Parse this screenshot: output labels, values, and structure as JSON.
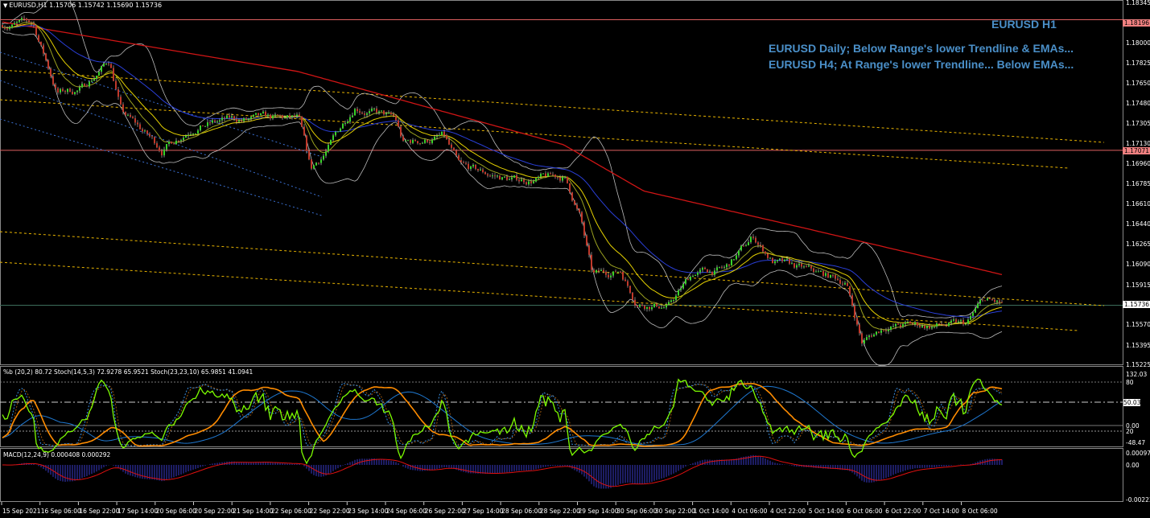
{
  "header": {
    "symbol": "EURUSD,H1",
    "ohlc": "1.15706 1.15742 1.15690 1.15736"
  },
  "annotations": [
    "EURUSD H1",
    "EURUSD Daily; Below Range's lower Trendline & EMAs...",
    "EURUSD H4; At Range's lower Trendline... Below EMAs..."
  ],
  "price_axis": [
    "1.18345",
    "1.18175",
    "1.18000",
    "1.17825",
    "1.17650",
    "1.17480",
    "1.17305",
    "1.17130",
    "1.16960",
    "1.16785",
    "1.16610",
    "1.16440",
    "1.16265",
    "1.16090",
    "1.15915",
    "1.15570",
    "1.15395",
    "1.15225"
  ],
  "price_tags": {
    "resistance": "1.18196",
    "support": "1.17071",
    "current": "1.15736"
  },
  "indicator_window": {
    "label": "%b (20,2) 80.72  Stoch(14,5,3) 72.9278 65.9521  Stoch(23,23,10) 65.9851 41.0941",
    "axis": [
      "132.03",
      "80",
      "50.03",
      "0.00",
      "20",
      "-48.47"
    ]
  },
  "macd_window": {
    "label": "MACD(12,24,9) 0.000408 0.000292",
    "axis": [
      "0.000973",
      "0.00",
      "-0.002224"
    ]
  },
  "time_axis": [
    "15 Sep 2021",
    "16 Sep 06:00",
    "16 Sep 22:00",
    "17 Sep 14:00",
    "20 Sep 06:00",
    "20 Sep 22:00",
    "21 Sep 14:00",
    "22 Sep 06:00",
    "22 Sep 22:00",
    "23 Sep 14:00",
    "24 Sep 06:00",
    "26 Sep 22:00",
    "27 Sep 14:00",
    "28 Sep 06:00",
    "28 Sep 22:00",
    "29 Sep 14:00",
    "30 Sep 06:00",
    "30 Sep 22:00",
    "1 Oct 14:00",
    "4 Oct 06:00",
    "4 Oct 22:00",
    "5 Oct 14:00",
    "6 Oct 06:00",
    "6 Oct 22:00",
    "7 Oct 14:00",
    "8 Oct 06:00"
  ],
  "colors": {
    "bull": "#39d22a",
    "bear": "#c0392b",
    "ema_slow": "#d01515",
    "ema_mid": "#2a3fd8",
    "ema_fast": "#e6d200",
    "trend": "#e8b400",
    "annotation": "#4a8fc8"
  },
  "chart_data": {
    "type": "candlestick",
    "price_path_anchors": [
      [
        0,
        1.1816
      ],
      [
        40,
        1.1816
      ],
      [
        70,
        1.1757
      ],
      [
        100,
        1.176
      ],
      [
        135,
        1.1785
      ],
      [
        150,
        1.174
      ],
      [
        200,
        1.1708
      ],
      [
        240,
        1.1729
      ],
      [
        290,
        1.1733
      ],
      [
        370,
        1.1733
      ],
      [
        385,
        1.1688
      ],
      [
        410,
        1.1712
      ],
      [
        440,
        1.1747
      ],
      [
        490,
        1.1733
      ],
      [
        500,
        1.1712
      ],
      [
        550,
        1.1719
      ],
      [
        570,
        1.1691
      ],
      [
        640,
        1.1681
      ],
      [
        700,
        1.1684
      ],
      [
        720,
        1.165
      ],
      [
        735,
        1.1598
      ],
      [
        770,
        1.1604
      ],
      [
        790,
        1.1577
      ],
      [
        830,
        1.1573
      ],
      [
        860,
        1.1601
      ],
      [
        900,
        1.1604
      ],
      [
        935,
        1.1632
      ],
      [
        960,
        1.1611
      ],
      [
        1010,
        1.1601
      ],
      [
        1050,
        1.1594
      ],
      [
        1070,
        1.1542
      ],
      [
        1100,
        1.1556
      ],
      [
        1200,
        1.1556
      ],
      [
        1220,
        1.1577
      ],
      [
        1245,
        1.15736
      ]
    ],
    "ema_slow_anchors": [
      [
        0,
        1.1818
      ],
      [
        370,
        1.1775
      ],
      [
        700,
        1.1712
      ],
      [
        800,
        1.1672
      ],
      [
        1000,
        1.164
      ],
      [
        1245,
        1.16
      ]
    ]
  }
}
